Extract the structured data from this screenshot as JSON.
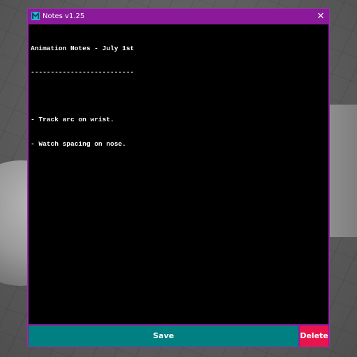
{
  "window": {
    "title": "Notes v1.25",
    "app_icon": "notes-app-icon",
    "close_label": "✕",
    "accent_color": "#8b1a9a"
  },
  "editor": {
    "lines": [
      "Animation Notes - July 1st",
      "--------------------------",
      "",
      "- Track arc on wrist.",
      "- Watch spacing on nose."
    ]
  },
  "buttons": {
    "save_label": "Save",
    "save_color": "#008080",
    "delete_label": "Delete",
    "delete_color": "#e8154d"
  }
}
